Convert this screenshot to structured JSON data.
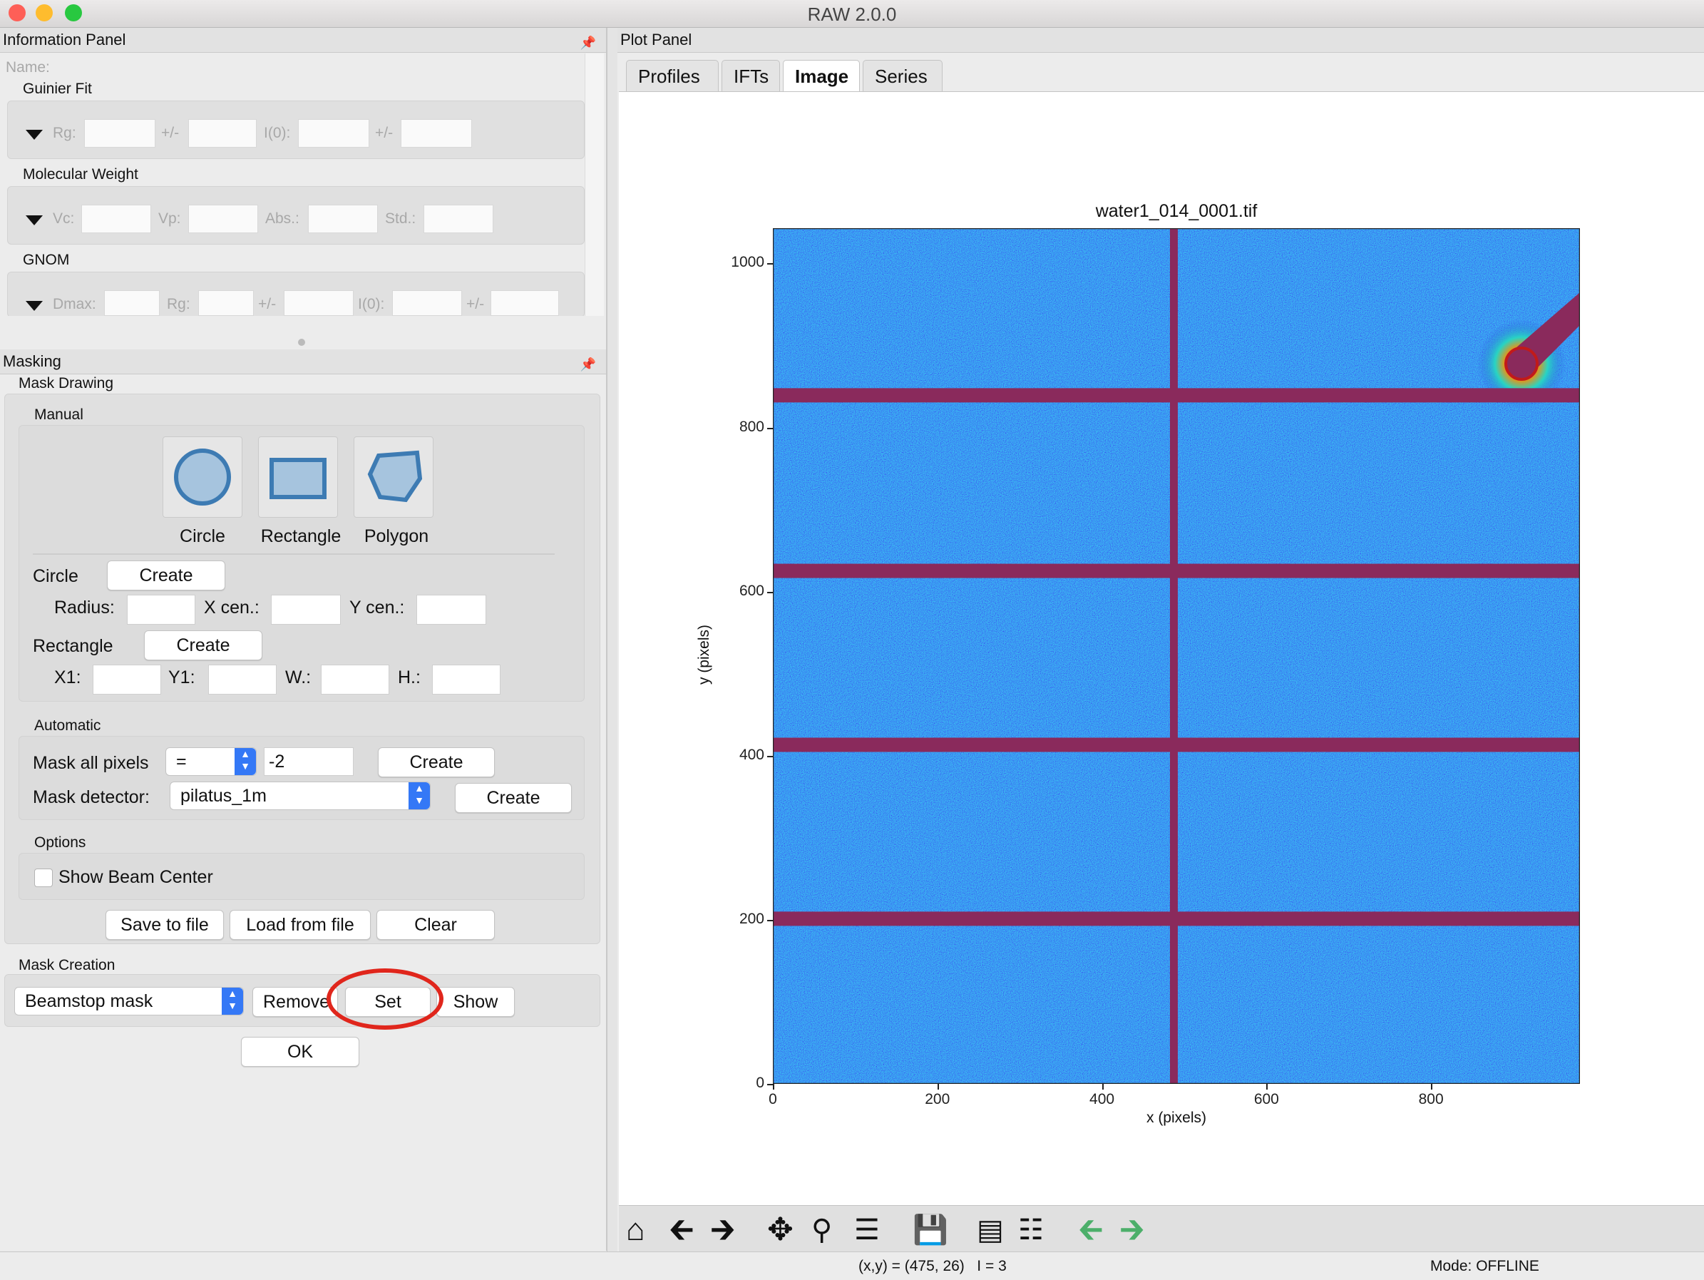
{
  "window": {
    "title": "RAW 2.0.0"
  },
  "info_panel": {
    "header": "Information Panel",
    "name_label": "Name:",
    "guinier": {
      "title": "Guinier Fit",
      "rg": "Rg:",
      "pm1": "+/-",
      "i0": "I(0):",
      "pm2": "+/-"
    },
    "mw": {
      "title": "Molecular Weight",
      "vc": "Vc:",
      "vp": "Vp:",
      "abs": "Abs.:",
      "std": "Std.:"
    },
    "gnom": {
      "title": "GNOM",
      "dmax": "Dmax:",
      "rg": "Rg:",
      "pm1": "+/-",
      "i0": "I(0):",
      "pm2": "+/-"
    }
  },
  "masking": {
    "header": "Masking",
    "mask_drawing": "Mask Drawing",
    "manual": {
      "title": "Manual",
      "tools": [
        "Circle",
        "Rectangle",
        "Polygon"
      ],
      "circle_label": "Circle",
      "circle_create": "Create",
      "radius": "Radius:",
      "xcen": "X cen.:",
      "ycen": "Y cen.:",
      "rect_label": "Rectangle",
      "rect_create": "Create",
      "x1": "X1:",
      "y1": "Y1:",
      "w": "W.:",
      "h": "H.:"
    },
    "automatic": {
      "title": "Automatic",
      "mask_all": "Mask all pixels",
      "op": "=",
      "value": "-2",
      "create1": "Create",
      "mask_detector": "Mask detector:",
      "detector": "pilatus_1m",
      "create2": "Create"
    },
    "options": {
      "title": "Options",
      "show_beam": "Show Beam Center",
      "show_beam_checked": false
    },
    "file_buttons": {
      "save": "Save to file",
      "load": "Load from file",
      "clear": "Clear"
    },
    "creation": {
      "title": "Mask Creation",
      "mask_type": "Beamstop mask",
      "remove": "Remove",
      "set": "Set",
      "show": "Show"
    },
    "ok": "OK"
  },
  "plot_panel": {
    "header": "Plot Panel",
    "tabs": [
      "Profiles",
      "IFTs",
      "Image",
      "Series"
    ],
    "active_tab": "Image",
    "image": {
      "title": "water1_014_0001.tif",
      "xlabel": "x (pixels)",
      "ylabel": "y (pixels)",
      "xticks": [
        "0",
        "200",
        "400",
        "600",
        "800"
      ],
      "yticks": [
        "0",
        "200",
        "400",
        "600",
        "800",
        "1000"
      ],
      "xlim": [
        0,
        981
      ],
      "ylim": [
        0,
        1043
      ]
    }
  },
  "toolbar_icons": [
    "home-icon",
    "back-arrow-icon",
    "forward-arrow-icon",
    "pan-icon",
    "zoom-icon",
    "configure-subplots-icon",
    "save-icon",
    "list-icon",
    "sliders-icon",
    "green-left-arrow-icon",
    "green-right-arrow-icon"
  ],
  "status": {
    "coords": "(x,y) = (475, 26)   I = 3",
    "mode": "Mode: OFFLINE"
  },
  "colors": {
    "accent": "#3478f6",
    "image_bg": "#2a56e0",
    "mask_band": "#8a2a5c",
    "highlight_circle": "#e02020"
  }
}
